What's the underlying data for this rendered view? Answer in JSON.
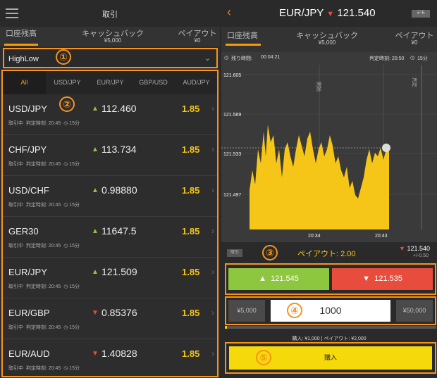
{
  "left": {
    "header_title": "取引",
    "summary": [
      {
        "label": "口座残高",
        "value": ""
      },
      {
        "label": "キャッシュバック",
        "value": "¥5,000"
      },
      {
        "label": "ペイアウト",
        "value": "¥0"
      }
    ],
    "dropdown_value": "HighLow",
    "callout_1": "①",
    "callout_2": "②",
    "tabs": [
      "All",
      "USD/JPY",
      "EUR/JPY",
      "GBP/USD",
      "AUD/JPY"
    ],
    "rows": [
      {
        "pair": "USD/JPY",
        "direction": "up",
        "price": "112.460",
        "payout": "1.85",
        "status": "取引中",
        "time": "判定時刻: 20:45",
        "duration": "15分"
      },
      {
        "pair": "CHF/JPY",
        "direction": "up",
        "price": "113.734",
        "payout": "1.85",
        "status": "取引中",
        "time": "判定時刻: 20:45",
        "duration": "15分"
      },
      {
        "pair": "USD/CHF",
        "direction": "up",
        "price": "0.98880",
        "payout": "1.85",
        "status": "取引中",
        "time": "判定時刻: 20:45",
        "duration": "15分"
      },
      {
        "pair": "GER30",
        "direction": "up",
        "price": "11647.5",
        "payout": "1.85",
        "status": "取引中",
        "time": "判定時刻: 20:45",
        "duration": "15分"
      },
      {
        "pair": "EUR/JPY",
        "direction": "up",
        "price": "121.509",
        "payout": "1.85",
        "status": "取引中",
        "time": "判定時刻: 20:45",
        "duration": "15分"
      },
      {
        "pair": "EUR/GBP",
        "direction": "down",
        "price": "0.85376",
        "payout": "1.85",
        "status": "取引中",
        "time": "判定時刻: 20:45",
        "duration": "15分"
      },
      {
        "pair": "EUR/AUD",
        "direction": "down",
        "price": "1.40828",
        "payout": "1.85",
        "status": "取引中",
        "time": "判定時刻: 20:45",
        "duration": "15分"
      }
    ]
  },
  "right": {
    "pair": "EUR/JPY",
    "price": "121.540",
    "demo_label": "デモ",
    "summary": [
      {
        "label": "口座残高",
        "value": ""
      },
      {
        "label": "キャッシュバック",
        "value": "¥5,000"
      },
      {
        "label": "ペイアウト",
        "value": "¥0"
      }
    ],
    "remaining_label": "残り時間:",
    "remaining_value": "00:04:21",
    "judge_label": "判定時刻: 20:50",
    "duration": "15分",
    "chart_y_labels": [
      "121.605",
      "121.569",
      "121.533",
      "121.497"
    ],
    "chart_x_labels": [
      "20:34",
      "20:43"
    ],
    "chart_vertical_labels": [
      "開始",
      "判定"
    ],
    "small_tag": "取引",
    "callout_3": "③",
    "payout_text": "ペイアウト: 2.00",
    "side_price": "121.540",
    "side_change": "+/-0.50",
    "high_price": "121.545",
    "low_price": "121.535",
    "callout_4": "④",
    "amount_minus": "¥5,000",
    "amount_value": "1000",
    "amount_plus": "¥50,000",
    "slider_fraction": 0.01,
    "purchase_info": "購入: ¥1,000  |  ペイアウト: ¥2,000",
    "callout_5": "⑤",
    "buy_label": "購入"
  },
  "colors": {
    "accent": "#f7931e",
    "high": "#8dc63f",
    "low": "#e74c3c",
    "payout": "#f5c518",
    "chart_fill": "#f5c518"
  }
}
